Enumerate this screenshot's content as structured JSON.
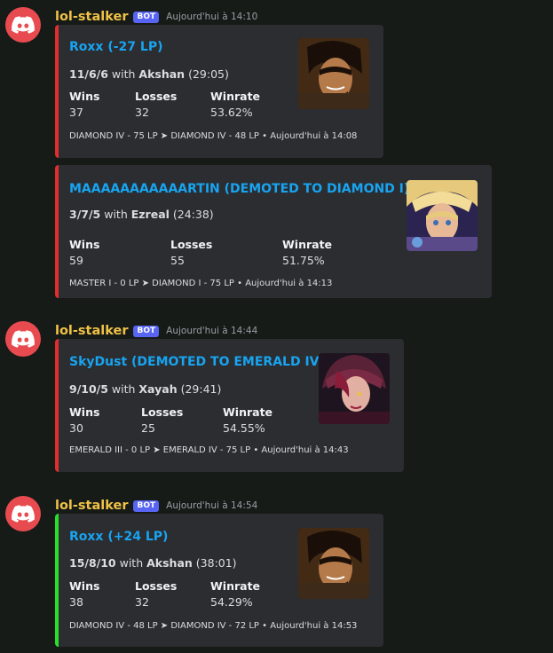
{
  "messages": [
    {
      "author": "lol-stalker",
      "badge": "BOT",
      "timestamp": "Aujourd'hui à 14:10",
      "embeds": [
        {
          "title": "Roxx (-27 LP)",
          "kda": "11/6/6",
          "with_label": "with",
          "champion": "Akshan",
          "duration": "(29:05)",
          "fields": {
            "wins_label": "Wins",
            "wins": "37",
            "losses_label": "Losses",
            "losses": "32",
            "winrate_label": "Winrate",
            "winrate": "53.62%"
          },
          "footer": "DIAMOND IV - 75 LP ➤ DIAMOND IV - 48 LP • Aujourd'hui à 14:08",
          "color": "#e02e2e",
          "thumbnail": "akshan-portrait"
        },
        {
          "title": "MAAAAAAAAAAARTIN (DEMOTED TO DIAMOND I)",
          "kda": "3/7/5",
          "with_label": "with",
          "champion": "Ezreal",
          "duration": "(24:38)",
          "fields": {
            "wins_label": "Wins",
            "wins": "59",
            "losses_label": "Losses",
            "losses": "55",
            "winrate_label": "Winrate",
            "winrate": "51.75%"
          },
          "footer": "MASTER I - 0 LP ➤ DIAMOND I - 75 LP • Aujourd'hui à 14:13",
          "color": "#e02e2e",
          "thumbnail": "ezreal-portrait"
        }
      ]
    },
    {
      "author": "lol-stalker",
      "badge": "BOT",
      "timestamp": "Aujourd'hui à 14:44",
      "embeds": [
        {
          "title": "SkyDust (DEMOTED TO EMERALD IV)",
          "kda": "9/10/5",
          "with_label": "with",
          "champion": "Xayah",
          "duration": "(29:41)",
          "fields": {
            "wins_label": "Wins",
            "wins": "30",
            "losses_label": "Losses",
            "losses": "25",
            "winrate_label": "Winrate",
            "winrate": "54.55%"
          },
          "footer": "EMERALD III - 0 LP ➤ EMERALD IV - 75 LP • Aujourd'hui à 14:43",
          "color": "#e02e2e",
          "thumbnail": "xayah-portrait"
        }
      ]
    },
    {
      "author": "lol-stalker",
      "badge": "BOT",
      "timestamp": "Aujourd'hui à 14:54",
      "embeds": [
        {
          "title": "Roxx (+24 LP)",
          "kda": "15/8/10",
          "with_label": "with",
          "champion": "Akshan",
          "duration": "(38:01)",
          "fields": {
            "wins_label": "Wins",
            "wins": "38",
            "losses_label": "Losses",
            "losses": "32",
            "winrate_label": "Winrate",
            "winrate": "54.29%"
          },
          "footer": "DIAMOND IV - 48 LP ➤ DIAMOND IV - 72 LP • Aujourd'hui à 14:53",
          "color": "#2adf2a",
          "thumbnail": "akshan-portrait"
        }
      ]
    }
  ]
}
